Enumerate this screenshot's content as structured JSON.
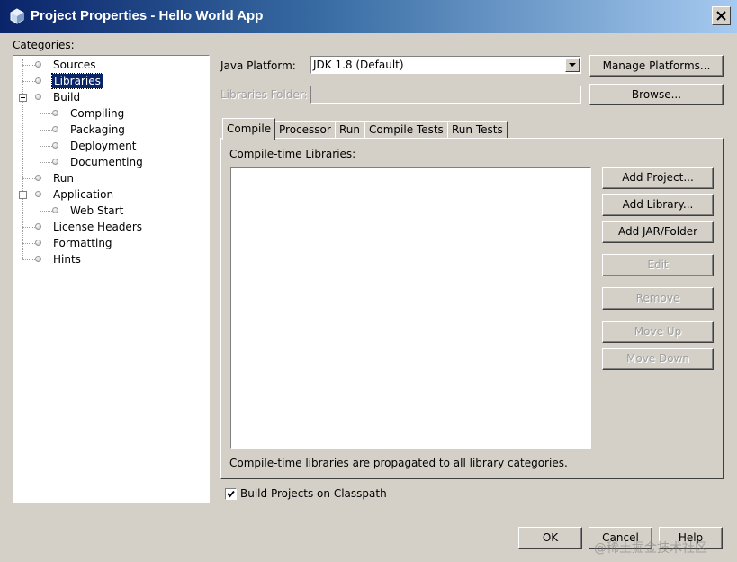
{
  "window": {
    "title": "Project Properties - Hello World App",
    "close_icon": "close-icon"
  },
  "categories": {
    "label": "Categories:",
    "items": [
      {
        "label": "Sources"
      },
      {
        "label": "Libraries",
        "selected": true
      },
      {
        "label": "Build",
        "expanded": true
      },
      {
        "label": "Compiling"
      },
      {
        "label": "Packaging"
      },
      {
        "label": "Deployment"
      },
      {
        "label": "Documenting"
      },
      {
        "label": "Run"
      },
      {
        "label": "Application",
        "expanded": true
      },
      {
        "label": "Web Start"
      },
      {
        "label": "License Headers"
      },
      {
        "label": "Formatting"
      },
      {
        "label": "Hints"
      }
    ]
  },
  "platform": {
    "label": "Java Platform:",
    "value": "JDK 1.8 (Default)",
    "manage_button": "Manage Platforms..."
  },
  "libraries_folder": {
    "label": "Libraries Folder:",
    "value": "",
    "browse_button": "Browse..."
  },
  "tabs": [
    {
      "label": "Compile",
      "active": true
    },
    {
      "label": "Processor"
    },
    {
      "label": "Run"
    },
    {
      "label": "Compile Tests"
    },
    {
      "label": "Run Tests"
    }
  ],
  "compile": {
    "list_label": "Compile-time Libraries:",
    "buttons": {
      "add_project": "Add Project...",
      "add_library": "Add Library...",
      "add_jar": "Add JAR/Folder",
      "edit": "Edit",
      "remove": "Remove",
      "move_up": "Move Up",
      "move_down": "Move Down"
    },
    "note": "Compile-time libraries are propagated to all library categories."
  },
  "build_on_classpath": {
    "label": "Build Projects on Classpath",
    "checked": true
  },
  "footer": {
    "ok": "OK",
    "cancel": "Cancel",
    "help": "Help"
  },
  "watermark": "@稀土掘金技术社区"
}
